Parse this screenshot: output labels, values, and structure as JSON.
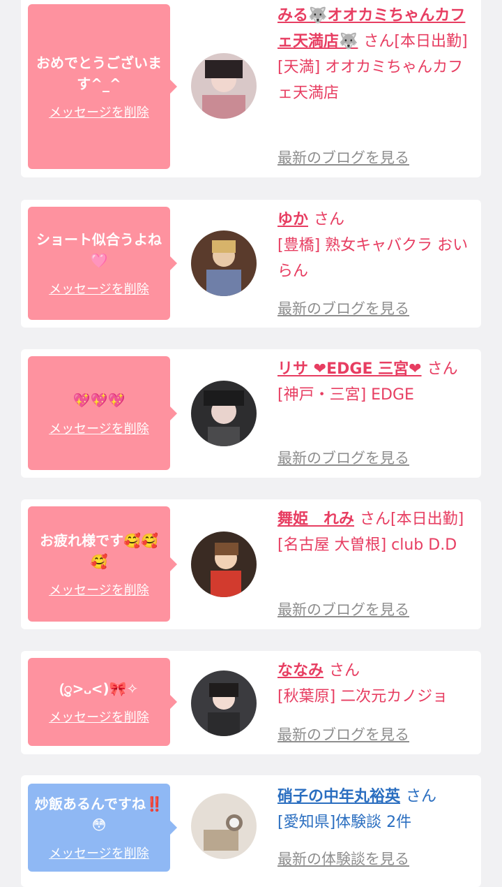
{
  "delete_label": "メッセージを削除",
  "cards": [
    {
      "message": "おめでとうございます^_^",
      "name": "みる🐺オオカミちゃんカフェ天満店🐺",
      "honorific": "さん",
      "status": "[本日出勤]",
      "shop": "[天満] オオカミちゃんカフェ天満店",
      "blog_link": "最新のブログを見る"
    },
    {
      "message": "ショート似合うよね🩷",
      "name": "ゆか",
      "honorific": "さん",
      "shop": "[豊橋] 熟女キャバクラ おいらん",
      "blog_link": "最新のブログを見る"
    },
    {
      "message": "💖💖💖",
      "name": "リサ ❤EDGE 三宮❤",
      "honorific": "さん",
      "shop": "[神戸・三宮] EDGE",
      "blog_link": "最新のブログを見る"
    },
    {
      "message": "お疲れ様です🥰🥰🥰",
      "name": "舞姫　れみ",
      "honorific": "さん",
      "status": "[本日出勤]",
      "shop": "[名古屋 大曽根] club D.D",
      "blog_link": "最新のブログを見る"
    },
    {
      "message": "(ु>᎑<)🎀✧",
      "name": "ななみ",
      "honorific": "さん",
      "shop": "[秋葉原] 二次元カノジョ",
      "blog_link": "最新のブログを見る"
    },
    {
      "message": "炒飯あるんですね‼️😳",
      "name": "硝子の中年丸裕英",
      "honorific": "さん",
      "shop": "[愛知県]体験談 2件",
      "blog_link": "最新の体験談を見る"
    }
  ],
  "colors": {
    "pink_bubble": "#fe929f",
    "blue_bubble": "#8fb8f4",
    "pink_text": "#e73d61",
    "blue_text": "#2a6ec0",
    "link_gray": "#8e8e8e"
  }
}
